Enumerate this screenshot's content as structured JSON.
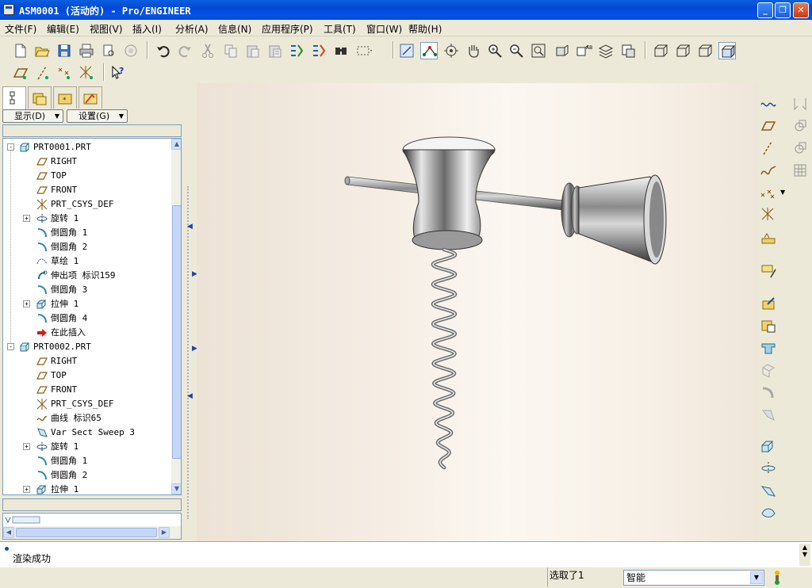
{
  "window": {
    "title": "ASM0001 (活动的) - Pro/ENGINEER",
    "controls": [
      "minimize",
      "restore",
      "close"
    ]
  },
  "menu": [
    {
      "label": "文件(F)"
    },
    {
      "label": "编辑(E)"
    },
    {
      "label": "视图(V)"
    },
    {
      "label": "插入(I)"
    },
    {
      "label": "分析(A)"
    },
    {
      "label": "信息(N)"
    },
    {
      "label": "应用程序(P)"
    },
    {
      "label": "工具(T)"
    },
    {
      "label": "窗口(W)"
    },
    {
      "label": "帮助(H)"
    }
  ],
  "left_panel": {
    "tabs": [
      "model-tree-tab",
      "layers-tab",
      "favorites-tab",
      "connections-tab"
    ],
    "show_label": "显示(D)",
    "settings_label": "设置(G)",
    "tree": [
      {
        "text": "PRT0001.PRT",
        "icon": "part-icon",
        "level": 0,
        "expander": "-"
      },
      {
        "text": "RIGHT",
        "icon": "datum-plane-icon",
        "level": 1
      },
      {
        "text": "TOP",
        "icon": "datum-plane-icon",
        "level": 1
      },
      {
        "text": "FRONT",
        "icon": "datum-plane-icon",
        "level": 1
      },
      {
        "text": "PRT_CSYS_DEF",
        "icon": "csys-icon",
        "level": 1
      },
      {
        "text": "旋转 1",
        "icon": "revolve-icon",
        "level": 1,
        "expander": "+"
      },
      {
        "text": "倒圆角 1",
        "icon": "round-icon",
        "level": 1
      },
      {
        "text": "倒圆角 2",
        "icon": "round-icon",
        "level": 1
      },
      {
        "text": "草绘 1",
        "icon": "sketch-icon",
        "level": 1
      },
      {
        "text": "伸出项 标识159",
        "icon": "protrusion-icon",
        "level": 1
      },
      {
        "text": "倒圆角 3",
        "icon": "round-icon",
        "level": 1
      },
      {
        "text": "拉伸 1",
        "icon": "extrude-icon",
        "level": 1,
        "expander": "+"
      },
      {
        "text": "倒圆角 4",
        "icon": "round-icon",
        "level": 1
      },
      {
        "text": "在此插入",
        "icon": "insert-here-arrow-icon",
        "level": 1
      },
      {
        "text": "PRT0002.PRT",
        "icon": "part-icon",
        "level": 0,
        "expander": "-"
      },
      {
        "text": "RIGHT",
        "icon": "datum-plane-icon",
        "level": 1
      },
      {
        "text": "TOP",
        "icon": "datum-plane-icon",
        "level": 1
      },
      {
        "text": "FRONT",
        "icon": "datum-plane-icon",
        "level": 1
      },
      {
        "text": "PRT_CSYS_DEF",
        "icon": "csys-icon",
        "level": 1
      },
      {
        "text": "曲线 标识65",
        "icon": "curve-icon",
        "level": 1
      },
      {
        "text": "Var Sect Sweep 3",
        "icon": "var-sect-sweep-icon",
        "level": 1
      },
      {
        "text": "旋转 1",
        "icon": "revolve-icon",
        "level": 1,
        "expander": "+"
      },
      {
        "text": "倒圆角 1",
        "icon": "round-icon",
        "level": 1
      },
      {
        "text": "倒圆角 2",
        "icon": "round-icon",
        "level": 1
      },
      {
        "text": "拉伸 1",
        "icon": "extrude-icon",
        "level": 1,
        "expander": "+"
      }
    ]
  },
  "toolbar_main": [
    "new-file-icon",
    "open-file-icon",
    "save-icon",
    "print-icon",
    "print-preview-icon",
    "email-icon",
    "undo-icon",
    "redo-icon",
    "cut-icon",
    "copy-icon",
    "paste-icon",
    "paste-special-icon",
    "regenerate-icon",
    "regen-manager-icon",
    "find-icon",
    "select-box-icon",
    "spin-center-icon",
    "orient-mode-icon",
    "pan-icon",
    "hand-icon",
    "zoom-in-icon",
    "zoom-out-icon",
    "refit-icon",
    "reorient-icon",
    "saved-views-icon",
    "layers-icon",
    "view-manager-icon",
    "wireframe-icon",
    "hidden-line-icon",
    "no-hidden-icon",
    "shading-icon"
  ],
  "toolbar_secondary": [
    "plane-display-icon",
    "axis-display-icon",
    "point-display-icon",
    "csys-display-icon",
    "context-help-icon"
  ],
  "right_toolbar": [
    "datum-plane-tool-icon",
    "datum-axis-tool-icon",
    "datum-curve-tool-icon",
    "datum-point-tool-icon",
    "datum-csys-tool-icon",
    "analysis-tool-icon",
    "sketch-tool-icon",
    "component-assemble-icon",
    "component-create-icon",
    "hole-tool-icon",
    "shell-tool-icon",
    "rib-tool-icon",
    "draft-tool-icon",
    "extrude-tool-icon",
    "revolve-tool-icon",
    "sweep-tool-icon",
    "blend-tool-icon"
  ],
  "status": {
    "message": "渲染成功",
    "selected": "选取了1",
    "filter_value": "智能"
  },
  "colors": {
    "title_bar": "#0a5fe0",
    "chrome": "#ece9d8",
    "tree_border": "#7f9db9"
  }
}
